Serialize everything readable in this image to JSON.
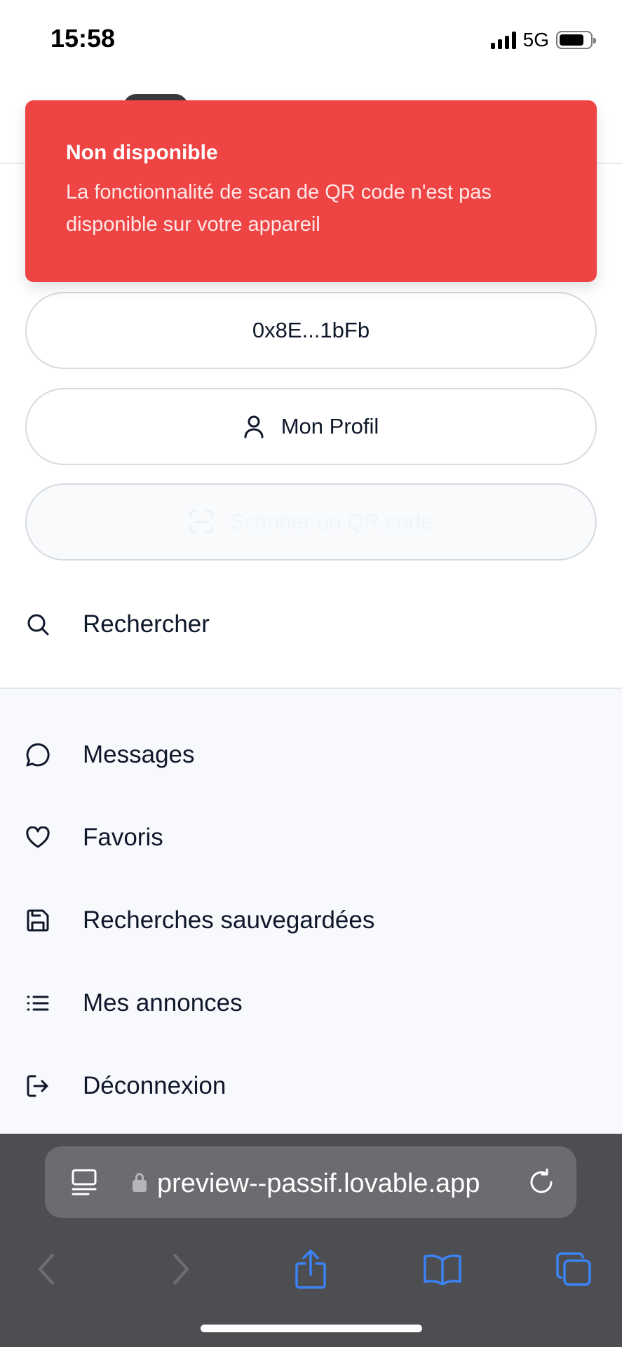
{
  "status_bar": {
    "time": "15:58",
    "network": "5G"
  },
  "toast": {
    "title": "Non disponible",
    "description": "La fonctionnalité de scan de QR code n'est pas disponible sur votre appareil",
    "color": "#ef4444"
  },
  "buttons": {
    "wallet_address": "0x8E...1bFb",
    "profile": "Mon Profil",
    "scan_qr": "Scanner un QR code"
  },
  "menu": {
    "search": "Rechercher",
    "items": [
      {
        "label": "Messages",
        "icon": "message-circle-icon"
      },
      {
        "label": "Favoris",
        "icon": "heart-icon"
      },
      {
        "label": "Recherches sauvegardées",
        "icon": "save-icon"
      },
      {
        "label": "Mes annonces",
        "icon": "list-icon"
      },
      {
        "label": "Déconnexion",
        "icon": "log-out-icon"
      }
    ]
  },
  "browser": {
    "url": "preview--passif.lovable.app",
    "accent_color": "#3b82f6"
  }
}
